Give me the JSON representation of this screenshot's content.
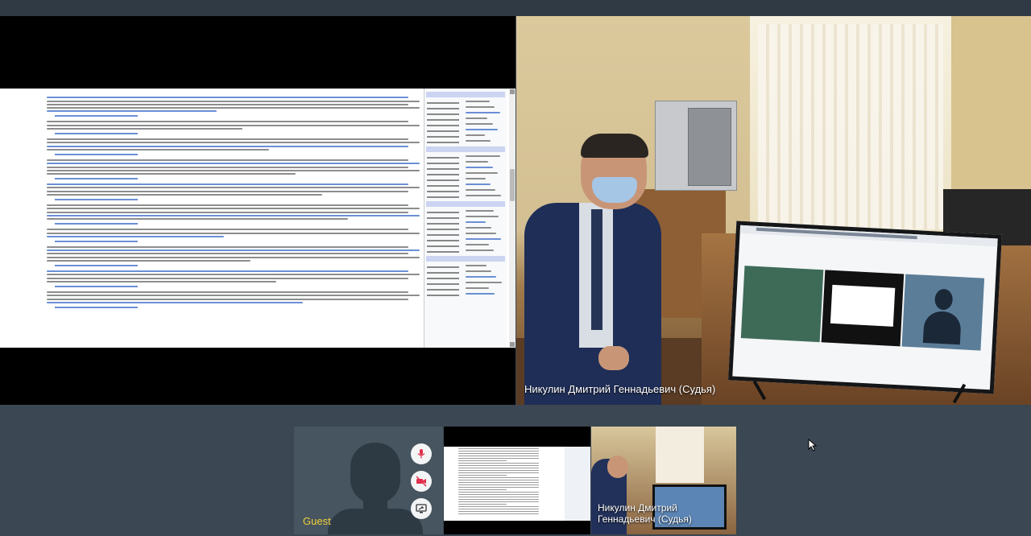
{
  "main_video": {
    "speaker_label": "Никулин Дмитрий Геннадьевич (Судья)"
  },
  "participants": [
    {
      "label": "Guest"
    },
    {
      "label": "Никулин Дмитрий Геннадьевич (Судья)"
    }
  ],
  "controls": {
    "mic": "microphone-icon",
    "camera": "camera-off-icon",
    "share": "screen-share-icon"
  },
  "colors": {
    "background": "#3b4752",
    "guest_label": "#f2cf3a",
    "control_red": "#e0304e"
  }
}
